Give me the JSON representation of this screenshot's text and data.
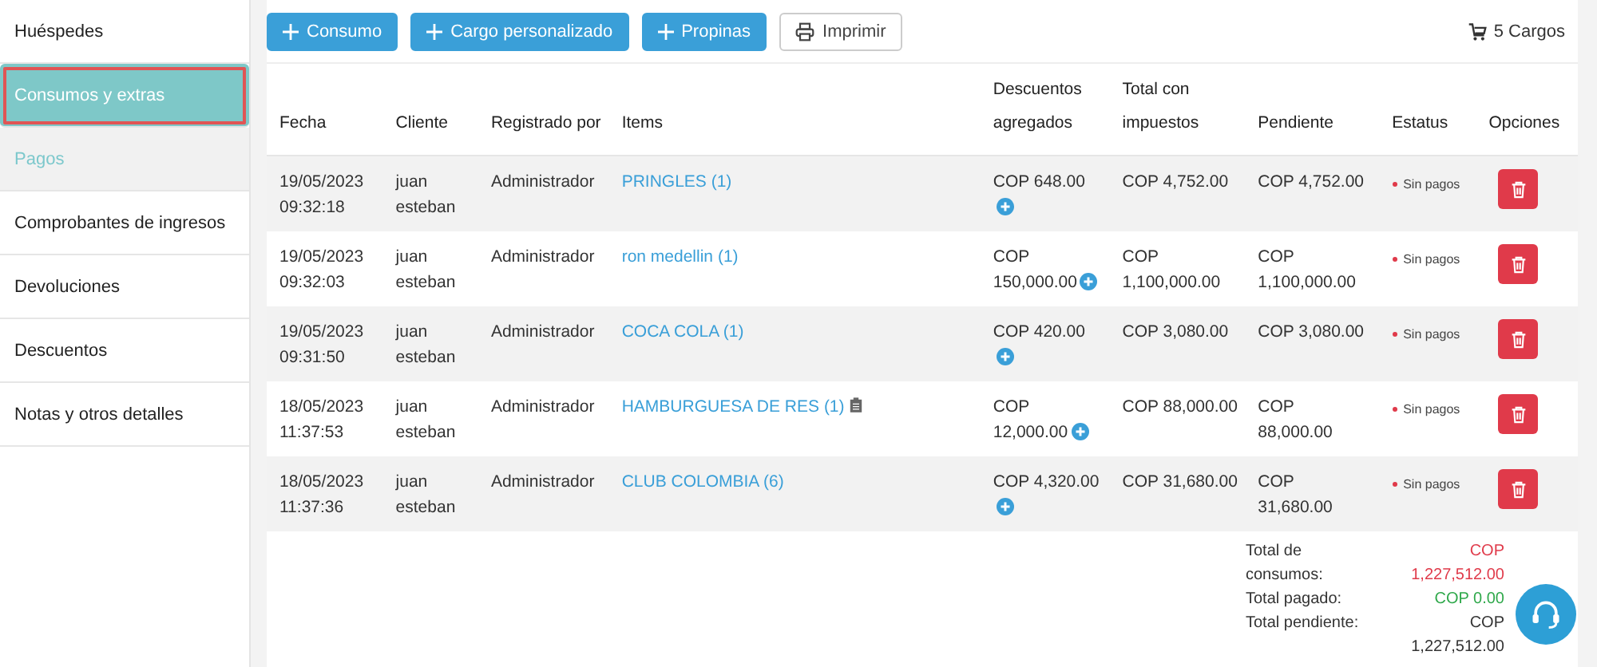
{
  "sidebar": {
    "items": [
      {
        "label": "Huéspedes",
        "selected": false,
        "hovered": false,
        "highlighted": false
      },
      {
        "label": "Consumos y extras",
        "selected": true,
        "hovered": false,
        "highlighted": true
      },
      {
        "label": "Pagos",
        "selected": false,
        "hovered": true,
        "highlighted": false
      },
      {
        "label": "Comprobantes de ingresos",
        "selected": false,
        "hovered": false,
        "highlighted": false
      },
      {
        "label": "Devoluciones",
        "selected": false,
        "hovered": false,
        "highlighted": false
      },
      {
        "label": "Descuentos",
        "selected": false,
        "hovered": false,
        "highlighted": false
      },
      {
        "label": "Notas y otros detalles",
        "selected": false,
        "hovered": false,
        "highlighted": false
      }
    ]
  },
  "toolbar": {
    "buttons": [
      {
        "label": "Consumo",
        "kind": "add"
      },
      {
        "label": "Cargo personalizado",
        "kind": "add"
      },
      {
        "label": "Propinas",
        "kind": "add"
      },
      {
        "label": "Imprimir",
        "kind": "print"
      }
    ],
    "count": "5 Cargos"
  },
  "table": {
    "columns": [
      "Fecha",
      "Cliente",
      "Registrado por",
      "Items",
      "Descuentos agregados",
      "Total con impuestos",
      "Pendiente",
      "Estatus",
      "Opciones"
    ],
    "rows": [
      {
        "fecha": "19/05/2023 09:32:18",
        "cliente": "juan esteban",
        "registrado": "Administrador",
        "items": "PRINGLES (1)",
        "note": false,
        "descuento": "COP 648.00",
        "total": "COP 4,752.00",
        "pendiente": "COP 4,752.00",
        "estatus": "Sin pagos"
      },
      {
        "fecha": "19/05/2023 09:32:03",
        "cliente": "juan esteban",
        "registrado": "Administrador",
        "items": "ron medellin (1)",
        "note": false,
        "descuento": "COP 150,000.00",
        "total": "COP 1,100,000.00",
        "pendiente": "COP 1,100,000.00",
        "estatus": "Sin pagos"
      },
      {
        "fecha": "19/05/2023 09:31:50",
        "cliente": "juan esteban",
        "registrado": "Administrador",
        "items": "COCA COLA (1)",
        "note": false,
        "descuento": "COP 420.00",
        "total": "COP 3,080.00",
        "pendiente": "COP 3,080.00",
        "estatus": "Sin pagos"
      },
      {
        "fecha": "18/05/2023 11:37:53",
        "cliente": "juan esteban",
        "registrado": "Administrador",
        "items": "HAMBURGUESA DE RES (1)",
        "note": true,
        "descuento": "COP 12,000.00",
        "total": "COP 88,000.00",
        "pendiente": "COP 88,000.00",
        "estatus": "Sin pagos"
      },
      {
        "fecha": "18/05/2023 11:37:36",
        "cliente": "juan esteban",
        "registrado": "Administrador",
        "items": "CLUB COLOMBIA (6)",
        "note": false,
        "descuento": "COP 4,320.00",
        "total": "COP 31,680.00",
        "pendiente": "COP 31,680.00",
        "estatus": "Sin pagos"
      }
    ]
  },
  "totals": [
    {
      "label": "Total de consumos:",
      "value": "COP 1,227,512.00",
      "kind": "charged"
    },
    {
      "label": "Total pagado:",
      "value": "COP 0.00",
      "kind": "paid"
    },
    {
      "label": "Total pendiente:",
      "value": "COP 1,227,512.00",
      "kind": "pending"
    }
  ]
}
